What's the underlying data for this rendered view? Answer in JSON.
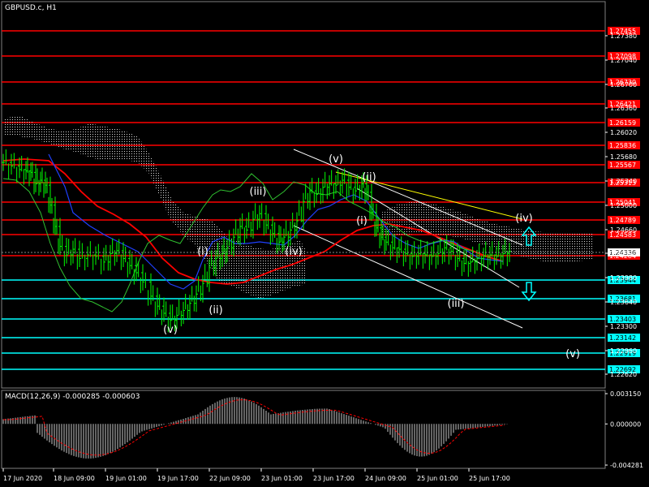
{
  "header": {
    "symbol_title": "GBPUSD.c, H1"
  },
  "macd": {
    "label": "MACD(12,26,9) -0.000285 -0.000603",
    "ticks": [
      "0.003150",
      "0.000000",
      "-0.004281"
    ]
  },
  "colors": {
    "background": "#000000",
    "resistance": "#ff0000",
    "support": "#00ffff",
    "price_bars": "#00ff00",
    "ma_red": "#ff0000",
    "ma_blue": "#2040ff",
    "chikou": "#30c030",
    "cloud_dots": "#d8d8d8",
    "channel": "#ffffff",
    "trendline": "#ffff00",
    "arrow": "#00ffff",
    "macd_hist": "#c8c8c8",
    "macd_signal": "#ff0000",
    "tag_text": "#ffffff",
    "price_tag_bg": "#ffffff",
    "price_tag_text": "#000000"
  },
  "chart_data": {
    "type": "candlestick",
    "title": "GBPUSD.c, H1",
    "xlabel": "",
    "ylabel": "",
    "ylim": [
      1.2243,
      1.2786
    ],
    "y_ticks": [
      "1.27380",
      "1.27040",
      "1.26700",
      "1.26360",
      "1.26020",
      "1.25680",
      "1.25340",
      "1.25000",
      "1.24660",
      "1.24320",
      "1.23980",
      "1.23640",
      "1.23300",
      "1.22960",
      "1.22620"
    ],
    "x_ticks": [
      "17 Jun 2020",
      "18 Jun 09:00",
      "19 Jun 01:00",
      "19 Jun 17:00",
      "22 Jun 09:00",
      "23 Jun 01:00",
      "23 Jun 17:00",
      "24 Jun 09:00",
      "25 Jun 01:00",
      "25 Jun 17:00"
    ],
    "current_price": "1.24336",
    "resistance_levels": [
      "1.27455",
      "1.27098",
      "1.26730",
      "1.26421",
      "1.26159",
      "1.25836",
      "1.25567",
      "1.25313",
      "1.25041",
      "1.24789",
      "1.24583",
      "1.24284"
    ],
    "support_levels": [
      "1.23944",
      "1.23681",
      "1.23403",
      "1.23142",
      "1.22919",
      "1.22692"
    ],
    "price_path": [
      [
        0,
        1.256
      ],
      [
        10,
        1.2555
      ],
      [
        20,
        1.255
      ],
      [
        28,
        1.2548
      ],
      [
        34,
        1.2546
      ],
      [
        40,
        1.253
      ],
      [
        46,
        1.2535
      ],
      [
        52,
        1.2528
      ],
      [
        58,
        1.25
      ],
      [
        64,
        1.247
      ],
      [
        70,
        1.2442
      ],
      [
        78,
        1.243
      ],
      [
        86,
        1.2438
      ],
      [
        94,
        1.2425
      ],
      [
        104,
        1.243
      ],
      [
        114,
        1.2428
      ],
      [
        124,
        1.242
      ],
      [
        132,
        1.2432
      ],
      [
        140,
        1.2436
      ],
      [
        148,
        1.2425
      ],
      [
        156,
        1.2415
      ],
      [
        164,
        1.2405
      ],
      [
        172,
        1.2392
      ],
      [
        182,
        1.2372
      ],
      [
        190,
        1.2358
      ],
      [
        198,
        1.2348
      ],
      [
        206,
        1.2338
      ],
      [
        214,
        1.2345
      ],
      [
        222,
        1.2352
      ],
      [
        230,
        1.2362
      ],
      [
        238,
        1.2375
      ],
      [
        246,
        1.239
      ],
      [
        254,
        1.2412
      ],
      [
        262,
        1.2425
      ],
      [
        270,
        1.2432
      ],
      [
        276,
        1.244
      ],
      [
        284,
        1.2455
      ],
      [
        292,
        1.247
      ],
      [
        300,
        1.2465
      ],
      [
        308,
        1.248
      ],
      [
        316,
        1.2488
      ],
      [
        324,
        1.2472
      ],
      [
        332,
        1.246
      ],
      [
        340,
        1.2448
      ],
      [
        346,
        1.2455
      ],
      [
        354,
        1.2465
      ],
      [
        362,
        1.2478
      ],
      [
        370,
        1.2505
      ],
      [
        378,
        1.252
      ],
      [
        386,
        1.2515
      ],
      [
        394,
        1.2525
      ],
      [
        402,
        1.253
      ],
      [
        410,
        1.2528
      ],
      [
        418,
        1.2535
      ],
      [
        426,
        1.2525
      ],
      [
        434,
        1.252
      ],
      [
        442,
        1.253
      ],
      [
        448,
        1.2518
      ],
      [
        454,
        1.249
      ],
      [
        460,
        1.2468
      ],
      [
        466,
        1.2455
      ],
      [
        472,
        1.2448
      ],
      [
        480,
        1.244
      ],
      [
        488,
        1.2438
      ],
      [
        496,
        1.2432
      ],
      [
        504,
        1.2428
      ],
      [
        512,
        1.2432
      ],
      [
        520,
        1.243
      ],
      [
        528,
        1.2428
      ],
      [
        536,
        1.2432
      ],
      [
        544,
        1.244
      ],
      [
        552,
        1.2435
      ],
      [
        560,
        1.2425
      ],
      [
        568,
        1.2418
      ],
      [
        576,
        1.242
      ],
      [
        584,
        1.2425
      ],
      [
        592,
        1.2428
      ],
      [
        600,
        1.243
      ],
      [
        608,
        1.2428
      ],
      [
        616,
        1.2432
      ],
      [
        624,
        1.2435
      ]
    ],
    "wave_labels": [
      "(v)",
      "(ii)",
      "(iii)",
      "(i)",
      "(iv)",
      "(i)",
      "(ii)",
      "(v)",
      "(iii)",
      "(iv)",
      "(v)"
    ],
    "grid": false,
    "legend": "none"
  }
}
